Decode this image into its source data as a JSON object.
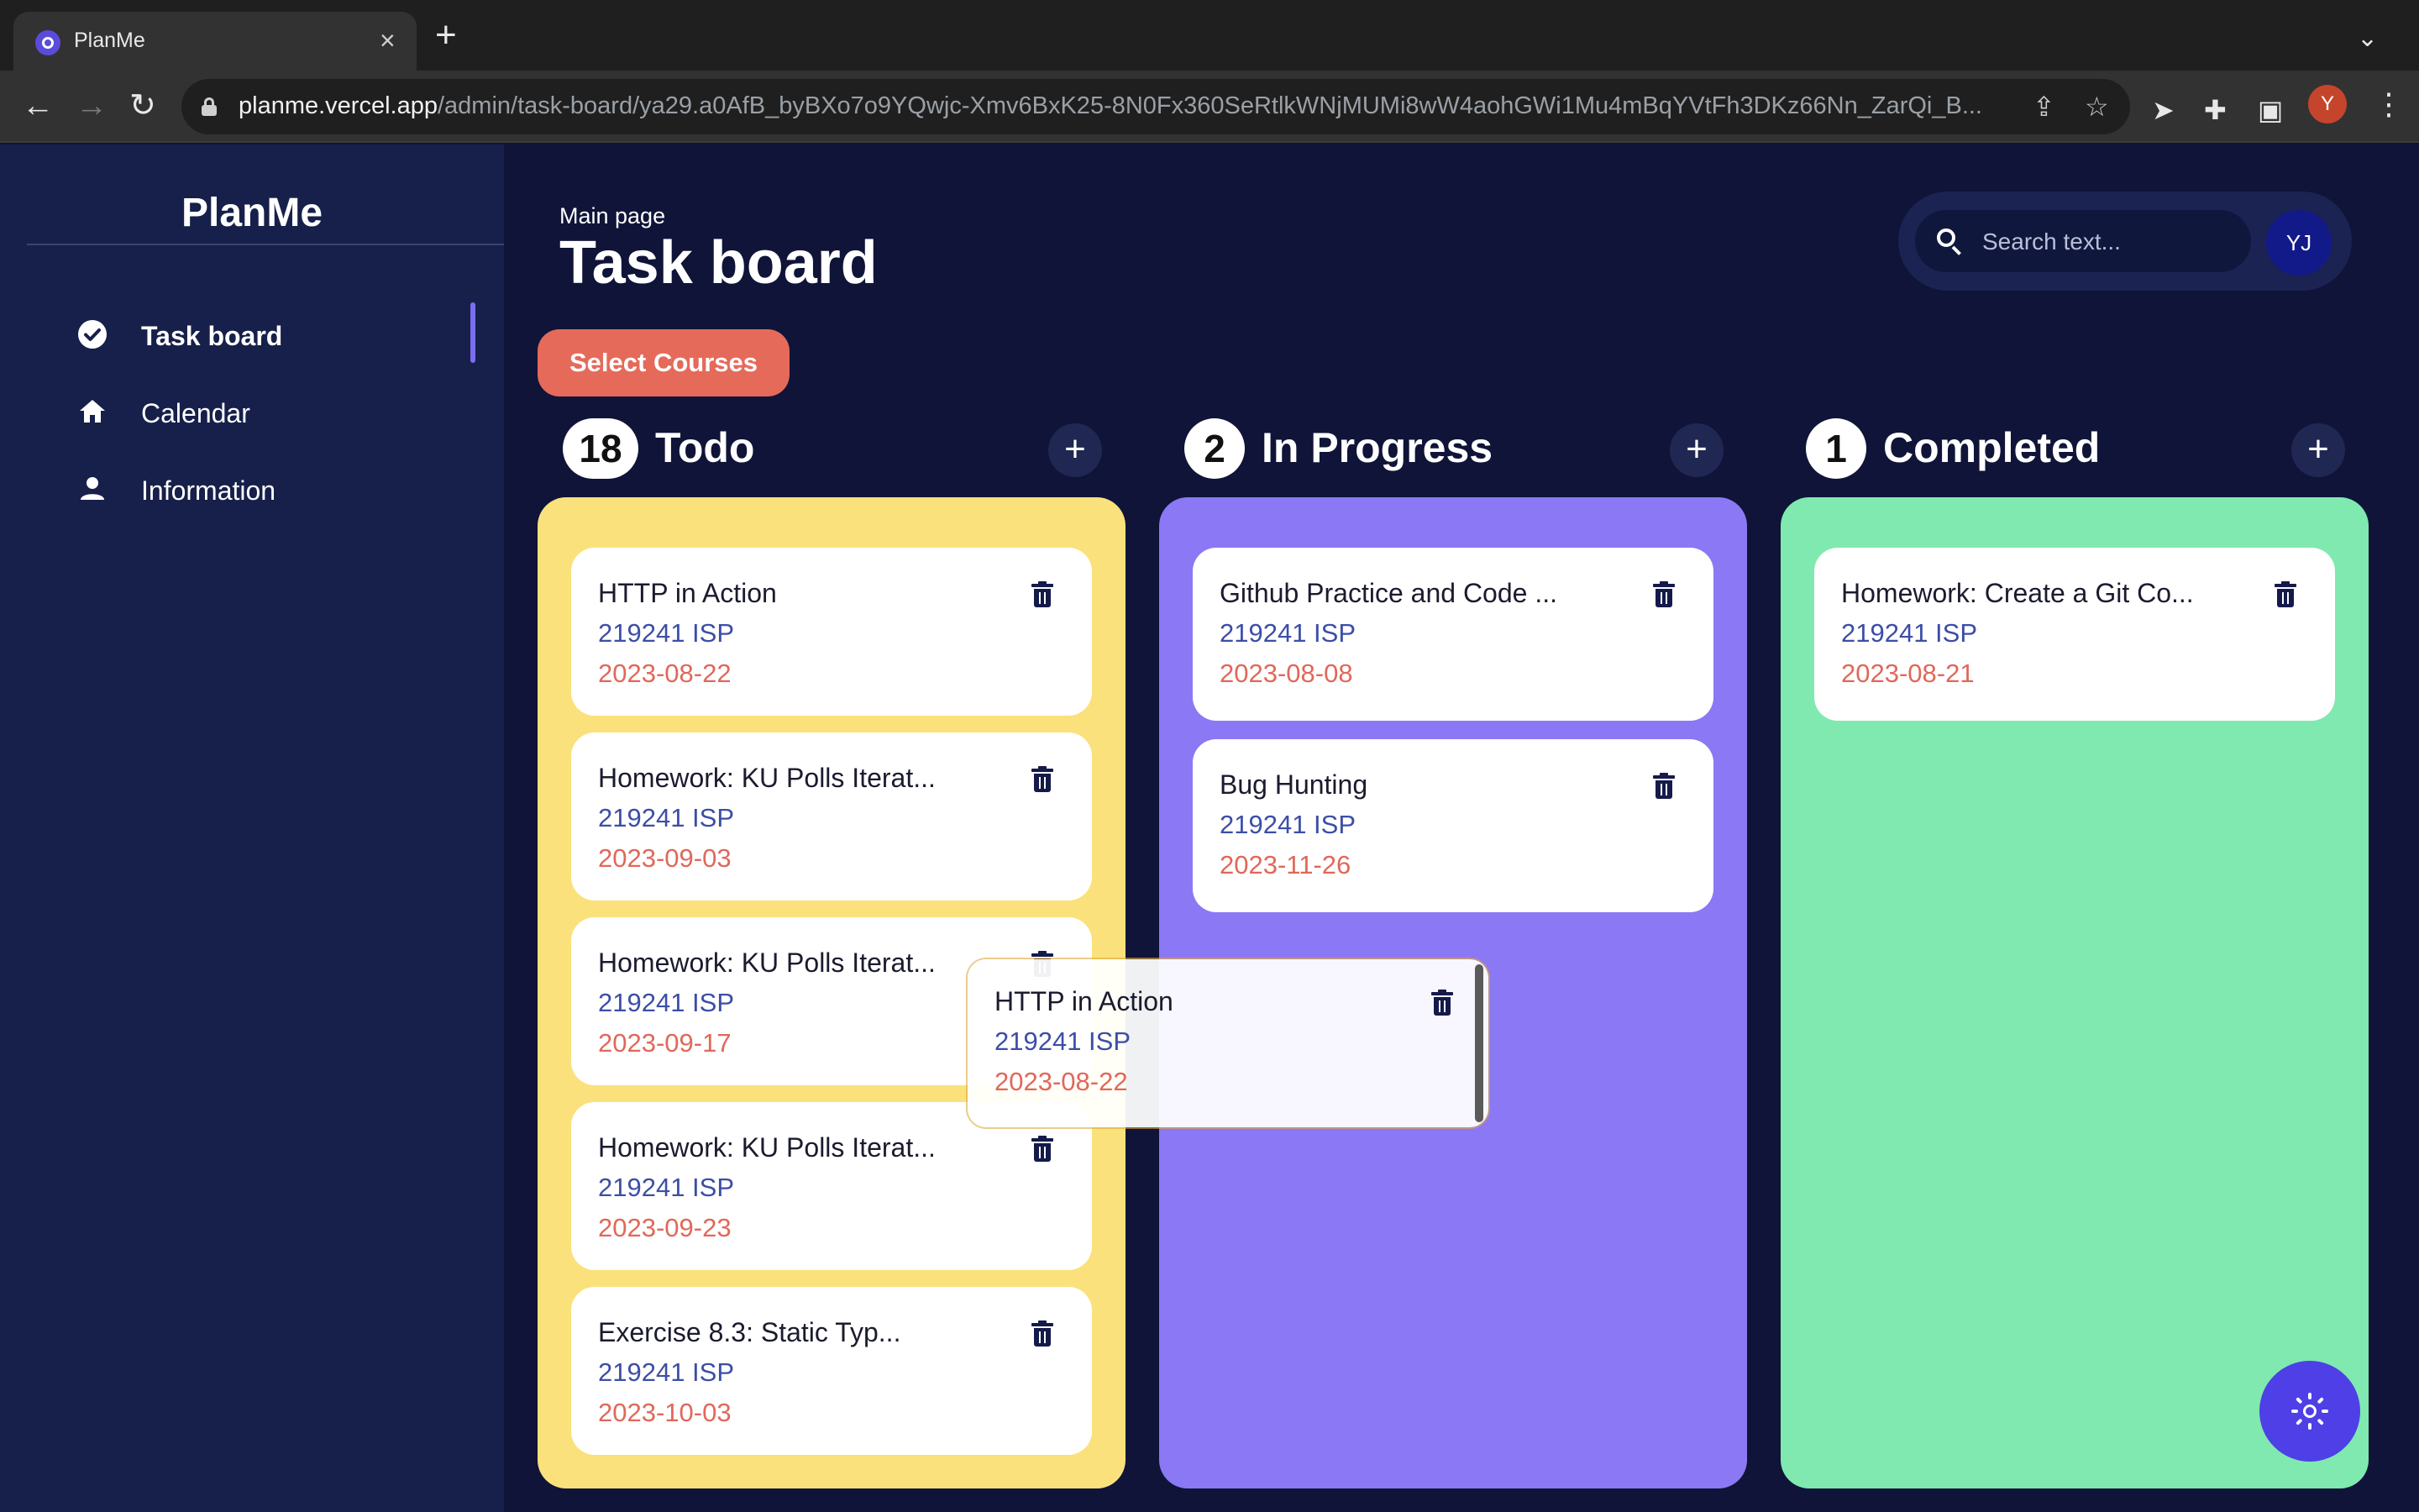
{
  "browser": {
    "tab_title": "PlanMe",
    "url_host": "planme.vercel.app",
    "url_path": "/admin/task-board/ya29.a0AfB_byBXo7o9YQwjc-Xmv6BxK25-8N0Fx360SeRtlkWNjMUMi8wW4aohGWi1Mu4mBqYVtFh3DKz66Nn_ZarQi_B...",
    "profile_initial": "Y"
  },
  "sidebar": {
    "brand": "PlanMe",
    "items": [
      {
        "label": "Task board",
        "icon": "check-circle-icon",
        "active": true
      },
      {
        "label": "Calendar",
        "icon": "home-icon",
        "active": false
      },
      {
        "label": "Information",
        "icon": "person-icon",
        "active": false
      }
    ]
  },
  "header": {
    "breadcrumb": "Main page",
    "title": "Task board",
    "search_placeholder": "Search text...",
    "avatar_initials": "YJ"
  },
  "actions": {
    "select_courses": "Select Courses"
  },
  "columns": [
    {
      "title": "Todo",
      "count": "18",
      "color": "#fbe17c",
      "cards": [
        {
          "title": "HTTP in Action",
          "course": "219241 ISP",
          "date": "2023-08-22"
        },
        {
          "title": "Homework: KU Polls Iterat...",
          "course": "219241 ISP",
          "date": "2023-09-03"
        },
        {
          "title": "Homework: KU Polls Iterat...",
          "course": "219241 ISP",
          "date": "2023-09-17"
        },
        {
          "title": "Homework: KU Polls Iterat...",
          "course": "219241 ISP",
          "date": "2023-09-23"
        },
        {
          "title": "Exercise 8.3: Static Typ...",
          "course": "219241 ISP",
          "date": "2023-10-03"
        }
      ]
    },
    {
      "title": "In Progress",
      "count": "2",
      "color": "#8b78f4",
      "cards": [
        {
          "title": "Github Practice and Code ...",
          "course": "219241 ISP",
          "date": "2023-08-08"
        },
        {
          "title": "Bug Hunting",
          "course": "219241 ISP",
          "date": "2023-11-26"
        }
      ]
    },
    {
      "title": "Completed",
      "count": "1",
      "color": "#7fe9b0",
      "cards": [
        {
          "title": "Homework: Create a Git Co...",
          "course": "219241 ISP",
          "date": "2023-08-21"
        }
      ]
    }
  ],
  "dragging_card": {
    "title": "HTTP in Action",
    "course": "219241 ISP",
    "date": "2023-08-22"
  },
  "theme_toggle_icon": "sun-icon"
}
